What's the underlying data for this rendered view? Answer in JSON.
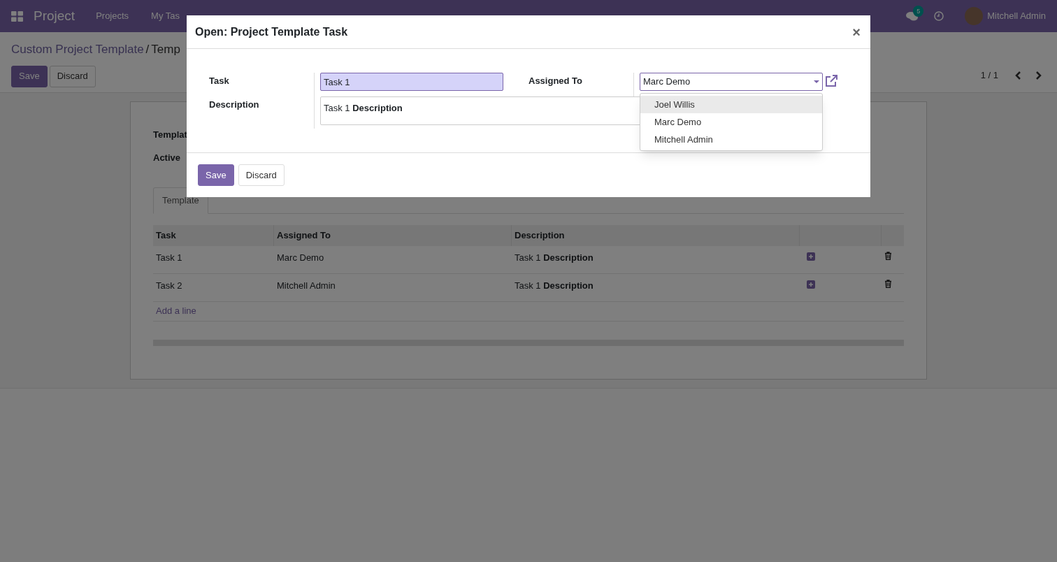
{
  "navbar": {
    "app_name": "Project",
    "menu": [
      "Projects",
      "My Tas"
    ],
    "messages_count": "5",
    "user_name": "Mitchell Admin"
  },
  "breadcrumb": [
    "Custom Project Template",
    "Temp"
  ],
  "breadcrumb_separator": "/",
  "buttons": [
    "Save",
    "Discard"
  ],
  "pager": "1 / 1",
  "form": {
    "fields": [
      "Templat",
      "Active"
    ],
    "tabs": [
      {
        "label": "Template",
        "selected": true
      }
    ],
    "table": {
      "columns": [
        "Task",
        "Assigned To",
        "Description"
      ],
      "rows": [
        {
          "task": "Task 1",
          "assigned_to": "Marc Demo",
          "description": "Task 1 **Description**"
        },
        {
          "task": "Task 2",
          "assigned_to": "Mitchell Admin",
          "description": "Task 1 **Description**"
        }
      ],
      "add_line": "Add a line"
    }
  },
  "dialog": {
    "title": "Open: Project Template Task",
    "close": "×",
    "task_label": "Task",
    "task_value": "Task 1",
    "assigned_label": "Assigned To",
    "assigned_value": "Marc Demo",
    "description_label": "Description",
    "description_value": "Task 1 **Description**",
    "dropdown": [
      {
        "label": "Joel Willis",
        "selected": true
      },
      {
        "label": "Marc Demo",
        "selected": false
      },
      {
        "label": "Mitchell Admin",
        "selected": false
      }
    ],
    "buttons": [
      "Save",
      "Discard"
    ]
  }
}
